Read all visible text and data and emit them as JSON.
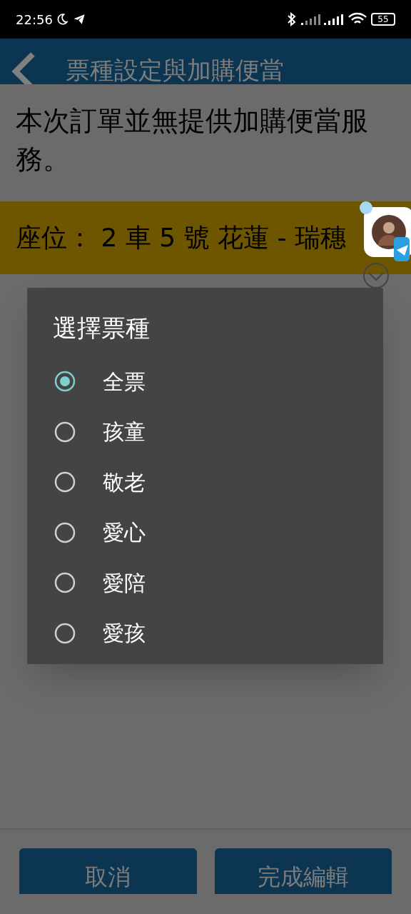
{
  "status_bar": {
    "time": "22:56",
    "battery": "55"
  },
  "header": {
    "title": "票種設定與加購便當"
  },
  "notice": "本次訂單並無提供加購便當服務。",
  "seat": "座位： 2 車 5 號 花蓮 - 瑞穗",
  "dialog": {
    "title": "選擇票種",
    "options": [
      {
        "label": "全票",
        "selected": true
      },
      {
        "label": "孩童",
        "selected": false
      },
      {
        "label": "敬老",
        "selected": false
      },
      {
        "label": "愛心",
        "selected": false
      },
      {
        "label": "愛陪",
        "selected": false
      },
      {
        "label": "愛孩",
        "selected": false
      }
    ]
  },
  "buttons": [
    "取消",
    "完成編輯"
  ]
}
